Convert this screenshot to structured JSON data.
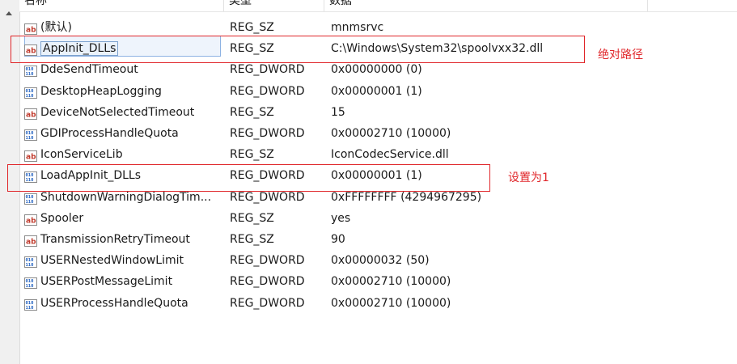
{
  "columns": {
    "name": "名称",
    "type": "类型",
    "data": "数据"
  },
  "rows": [
    {
      "name": "(默认)",
      "type": "REG_SZ",
      "data": "mnmsrvc",
      "icon": "string-value-icon"
    },
    {
      "name": "AppInit_DLLs",
      "type": "REG_SZ",
      "data": "C:\\Windows\\System32\\spoolvxx32.dll",
      "icon": "string-value-icon",
      "selected": true
    },
    {
      "name": "DdeSendTimeout",
      "type": "REG_DWORD",
      "data": "0x00000000 (0)",
      "icon": "binary-value-icon"
    },
    {
      "name": "DesktopHeapLogging",
      "type": "REG_DWORD",
      "data": "0x00000001 (1)",
      "icon": "binary-value-icon"
    },
    {
      "name": "DeviceNotSelectedTimeout",
      "type": "REG_SZ",
      "data": "15",
      "icon": "string-value-icon"
    },
    {
      "name": "GDIProcessHandleQuota",
      "type": "REG_DWORD",
      "data": "0x00002710 (10000)",
      "icon": "binary-value-icon"
    },
    {
      "name": "IconServiceLib",
      "type": "REG_SZ",
      "data": "IconCodecService.dll",
      "icon": "string-value-icon"
    },
    {
      "name": "LoadAppInit_DLLs",
      "type": "REG_DWORD",
      "data": "0x00000001 (1)",
      "icon": "binary-value-icon"
    },
    {
      "name": "ShutdownWarningDialogTim...",
      "type": "REG_DWORD",
      "data": "0xFFFFFFFF (4294967295)",
      "icon": "binary-value-icon"
    },
    {
      "name": "Spooler",
      "type": "REG_SZ",
      "data": "yes",
      "icon": "string-value-icon"
    },
    {
      "name": "TransmissionRetryTimeout",
      "type": "REG_SZ",
      "data": "90",
      "icon": "string-value-icon"
    },
    {
      "name": "USERNestedWindowLimit",
      "type": "REG_DWORD",
      "data": "0x00000032 (50)",
      "icon": "binary-value-icon"
    },
    {
      "name": "USERPostMessageLimit",
      "type": "REG_DWORD",
      "data": "0x00002710 (10000)",
      "icon": "binary-value-icon"
    },
    {
      "name": "USERProcessHandleQuota",
      "type": "REG_DWORD",
      "data": "0x00002710 (10000)",
      "icon": "binary-value-icon"
    }
  ],
  "annotations": {
    "absolute_path": "绝对路径",
    "set_to_1": "设置为1"
  },
  "colors": {
    "annotation": "#e0262a",
    "selection_border": "#7da2ce"
  }
}
